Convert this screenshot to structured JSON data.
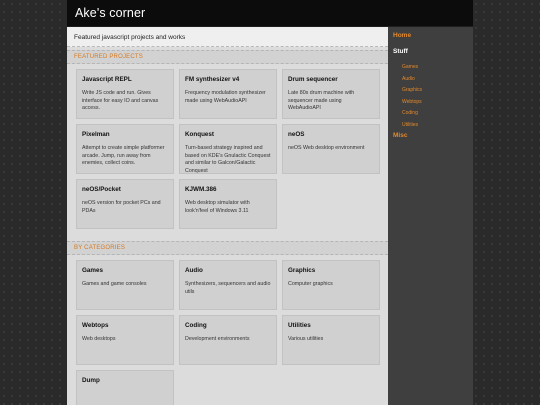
{
  "site": {
    "title": "Ake's corner"
  },
  "main": {
    "tagline": "Featured javascript projects and works",
    "featured_heading": "FEATURED PROJECTS",
    "featured": [
      {
        "title": "Javascript REPL",
        "desc": "Write JS code and run. Gives interface for easy IO and canvas access."
      },
      {
        "title": "FM synthesizer v4",
        "desc": "Frequency modulation synthesizer made using WebAudioAPI"
      },
      {
        "title": "Drum sequencer",
        "desc": "Late 80s drum machine with sequencer made using WebAudioAPI"
      },
      {
        "title": "Pixelman",
        "desc": "Attempt to create simple platformer arcade. Jump, run away from enemies, collect coins."
      },
      {
        "title": "Konquest",
        "desc": "Turn-based strategy inspired and based on KDE's Gnulactic Conquest and similar to Galcon/Galactic Conquest"
      },
      {
        "title": "neOS",
        "desc": "neOS Web desktop environment"
      },
      {
        "title": "neOS/Pocket",
        "desc": "neOS version for pocket PCs and PDAs"
      },
      {
        "title": "KJWM.386",
        "desc": "Web desktop simulator with look'n'feel of Windows 3.11"
      }
    ],
    "categories_heading": "BY CATEGORIES",
    "categories": [
      {
        "title": "Games",
        "desc": "Games and game consoles"
      },
      {
        "title": "Audio",
        "desc": "Synthesizers, sequencers and audio utils"
      },
      {
        "title": "Graphics",
        "desc": "Computer graphics"
      },
      {
        "title": "Webtops",
        "desc": "Web desktops"
      },
      {
        "title": "Coding",
        "desc": "Development environments"
      },
      {
        "title": "Utilities",
        "desc": "Various utilities"
      },
      {
        "title": "Dump",
        "desc": ""
      }
    ]
  },
  "sidebar": {
    "home": "Home",
    "stuff": "Stuff",
    "items": [
      "Games",
      "Audio",
      "Graphics",
      "Webtops",
      "Coding",
      "Utilities"
    ],
    "misc": "Misc"
  },
  "colors": {
    "accent": "#e08a2e",
    "header_bg": "#0c0c0c",
    "sidebar_bg": "#403f3f",
    "main_bg": "#dcdcdc"
  }
}
